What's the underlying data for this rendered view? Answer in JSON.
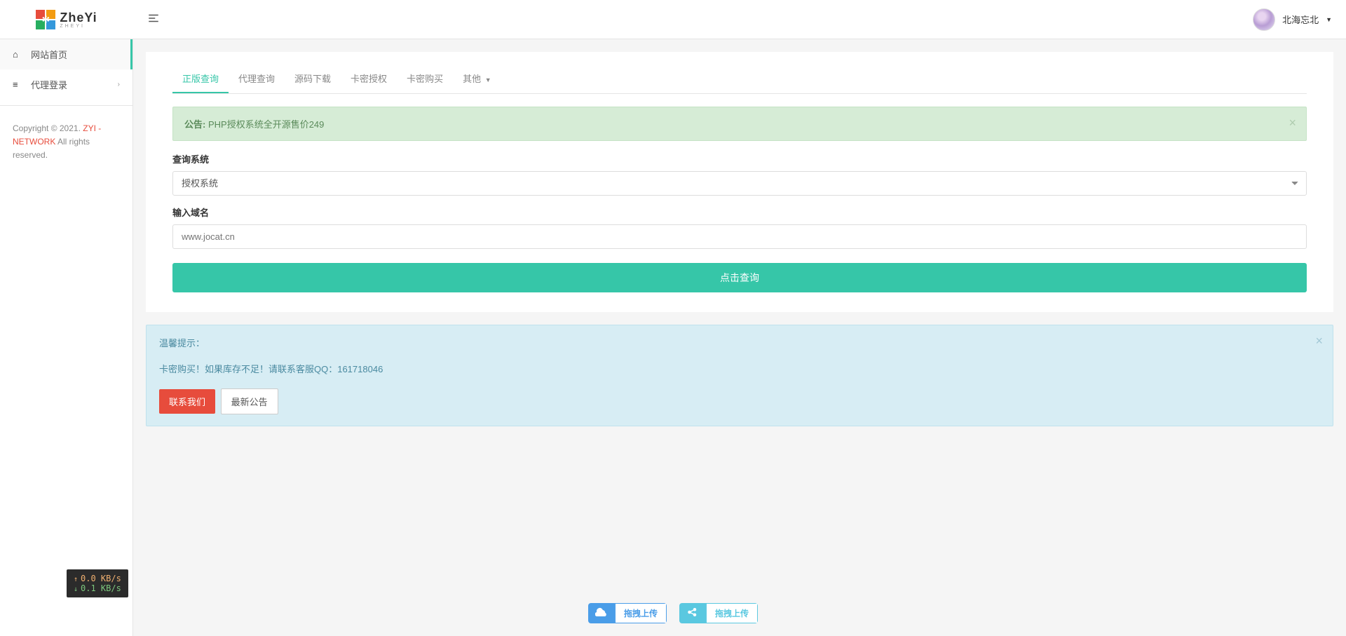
{
  "logo": {
    "text": "ZheYi",
    "subtext": "ZHEYI"
  },
  "user": {
    "name": "北海忘北"
  },
  "sidebar": {
    "items": [
      {
        "label": "网站首页"
      },
      {
        "label": "代理登录"
      }
    ]
  },
  "copyright": {
    "prefix": "Copyright © 2021. ",
    "link": "ZYI - NETWORK",
    "suffix": " All rights reserved."
  },
  "tabs": [
    {
      "label": "正版查询"
    },
    {
      "label": "代理查询"
    },
    {
      "label": "源码下载"
    },
    {
      "label": "卡密授权"
    },
    {
      "label": "卡密购买"
    },
    {
      "label": "其他"
    }
  ],
  "notice": {
    "label": "公告:",
    "text": "PHP授权系统全开源售价249"
  },
  "form": {
    "system_label": "查询系统",
    "system_value": "授权系统",
    "domain_label": "输入域名",
    "domain_placeholder": "www.jocat.cn",
    "submit": "点击查询"
  },
  "tips": {
    "title": "温馨提示：",
    "content": "卡密购买！如果库存不足！请联系客服QQ：161718046",
    "contact_btn": "联系我们",
    "news_btn": "最新公告"
  },
  "upload": {
    "blue": "拖拽上传",
    "cyan": "拖拽上传"
  },
  "speed": {
    "up": "0.0 KB/s",
    "down": "0.1 KB/s"
  }
}
